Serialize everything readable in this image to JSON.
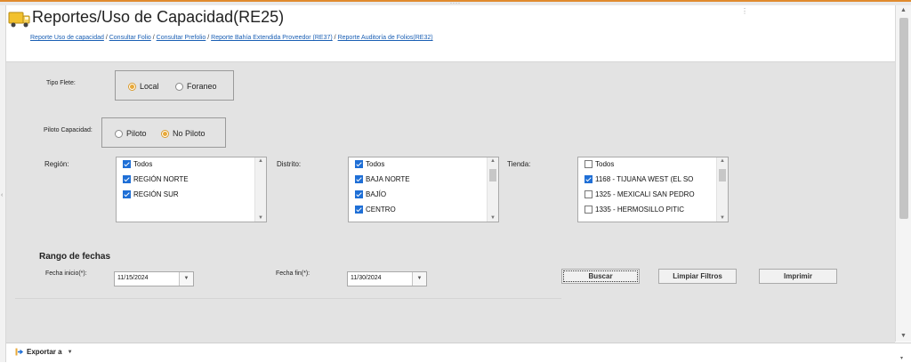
{
  "header": {
    "title": "Reportes/Uso de Capacidad(RE25)",
    "breadcrumb": [
      "Reporte Uso de capacidad",
      "Consultar Folio",
      "Consultar Prefolio",
      "Reporte Bahía Extendida Proveedor (RE37)",
      "Reporte Auditoría de Folios(RE32)"
    ],
    "separator": " / "
  },
  "tipo_flete": {
    "label": "Tipo Flete:",
    "options": [
      {
        "label": "Local",
        "selected": true
      },
      {
        "label": "Foraneo",
        "selected": false
      }
    ]
  },
  "piloto_capacidad": {
    "label": "Piloto Capacidad:",
    "options": [
      {
        "label": "Piloto",
        "selected": false
      },
      {
        "label": "No Piloto",
        "selected": true
      }
    ]
  },
  "region": {
    "label": "Región:",
    "items": [
      {
        "label": "Todos",
        "checked": true
      },
      {
        "label": "REGIÓN NORTE",
        "checked": true
      },
      {
        "label": "REGIÓN SUR",
        "checked": true
      }
    ]
  },
  "distrito": {
    "label": "Distrito:",
    "items": [
      {
        "label": "Todos",
        "checked": true
      },
      {
        "label": "BAJA NORTE",
        "checked": true
      },
      {
        "label": "BAJÍO",
        "checked": true
      },
      {
        "label": "CENTRO",
        "checked": true
      }
    ]
  },
  "tienda": {
    "label": "Tienda:",
    "items": [
      {
        "label": "Todos",
        "checked": false
      },
      {
        "label": "1168 - TIJUANA WEST (EL SO",
        "checked": true
      },
      {
        "label": "1325 - MEXICALI SAN PEDRO",
        "checked": false
      },
      {
        "label": "1335 - HERMOSILLO PITIC",
        "checked": false
      }
    ]
  },
  "rango": {
    "title": "Rango de fechas",
    "inicio_label": "Fecha inicio(*):",
    "inicio_value": "11/15/2024",
    "fin_label": "Fecha fin(*):",
    "fin_value": "11/30/2024"
  },
  "buttons": {
    "buscar": "Buscar",
    "limpiar": "Limpiar Filtros",
    "imprimir": "Imprimir"
  },
  "footer": {
    "export_label": "Exportar a"
  },
  "colors": {
    "accent_orange": "#e8a93a",
    "check_blue": "#1f6fd6",
    "link_blue": "#1a5fb4",
    "panel_gray": "#e3e3e3"
  }
}
